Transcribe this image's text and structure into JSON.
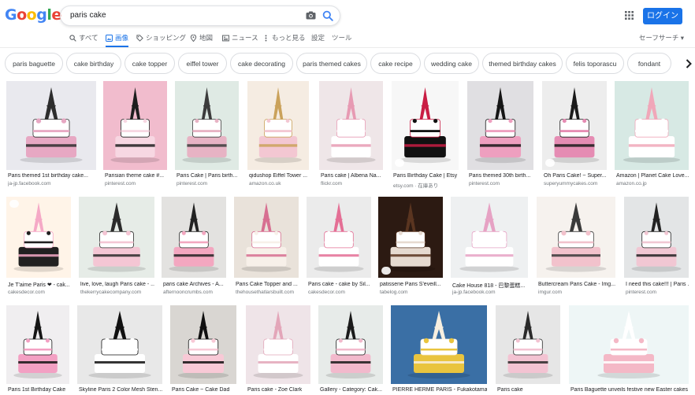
{
  "header": {
    "logo_letters": [
      "G",
      "o",
      "o",
      "g",
      "l",
      "e"
    ],
    "search_query": "paris cake",
    "login_label": "ログイン",
    "safesearch_label": "セーフサーチ ▾"
  },
  "tabs": [
    {
      "label": "すべて",
      "icon": "search-icon"
    },
    {
      "label": "画像",
      "icon": "image-icon",
      "active": true
    },
    {
      "label": "ショッピング",
      "icon": "tag-icon"
    },
    {
      "label": "地図",
      "icon": "map-pin-icon"
    },
    {
      "label": "ニュース",
      "icon": "news-icon"
    },
    {
      "label": "もっと見る",
      "icon": "more-icon"
    },
    {
      "label": "設定",
      "icon": ""
    },
    {
      "label": "ツール",
      "icon": ""
    }
  ],
  "chips": [
    "paris baguette",
    "cake birthday",
    "cake topper",
    "eiffel tower",
    "cake decorating",
    "paris themed cakes",
    "cake recipe",
    "wedding cake",
    "themed birthday cakes",
    "felis toporascu",
    "fondant"
  ],
  "results": [
    {
      "title": "Paris themed 1st birthday cake...",
      "source": "ja-jp.facebook.com",
      "colors": [
        "#e9e9ee",
        "#2d2d2d",
        "#e7a8c3"
      ]
    },
    {
      "title": "Parisian theme cake #...",
      "source": "pinterest.com",
      "colors": [
        "#f1bccd",
        "#1e1e1e",
        "#f7d7e2"
      ]
    },
    {
      "title": "Paris Cake | Paris birth...",
      "source": "pinterest.com",
      "colors": [
        "#dfeae4",
        "#3b3b3b",
        "#e7b3c4"
      ]
    },
    {
      "title": "qidushop Eiffel Tower ...",
      "source": "amazon.co.uk",
      "colors": [
        "#f5ece2",
        "#caa25b",
        "#f3c7d2"
      ]
    },
    {
      "title": "Paris cake | Albena Na...",
      "source": "flickr.com",
      "colors": [
        "#efe6e8",
        "#e79ab3",
        "#ffffff"
      ]
    },
    {
      "title": "Paris Birthday Cake | Etsy",
      "source": "etsy.com · 在庫あり",
      "colors": [
        "#f7f7f7",
        "#c91d44",
        "#111111"
      ],
      "badge": true
    },
    {
      "title": "Paris themed 30th birth...",
      "source": "pinterest.com",
      "colors": [
        "#e0dfe2",
        "#151515",
        "#ee9fbf"
      ]
    },
    {
      "title": "Oh Paris Cake! ~ Super...",
      "source": "superyummycakes.com",
      "colors": [
        "#ededed",
        "#1a1a1a",
        "#e58cb3"
      ],
      "badge": true
    },
    {
      "title": "Amazon | Planet Cake Love...",
      "source": "amazon.co.jp",
      "colors": [
        "#d7e9e4",
        "#f0a7b9",
        "#ffffff"
      ]
    },
    {
      "title": "Je T'aime Paris ❤ - cak...",
      "source": "cakesdecor.com",
      "colors": [
        "#fff4e8",
        "#f5a9c6",
        "#202020"
      ],
      "badge": true
    },
    {
      "title": "live, love, laugh Paris cake - ...",
      "source": "thekerrycakecompany.com",
      "colors": [
        "#e6ece7",
        "#2b2b2b",
        "#f4c6d4"
      ]
    },
    {
      "title": "paris cake Archives - A...",
      "source": "afternooncrumbs.com",
      "colors": [
        "#e3e2e0",
        "#222222",
        "#f3a7c0"
      ]
    },
    {
      "title": "Paris Cake Topper and ...",
      "source": "thehousethatlarsbuilt.com",
      "colors": [
        "#e9e2da",
        "#d76f91",
        "#f7f0e9"
      ]
    },
    {
      "title": "Paris cake - cake by Sil...",
      "source": "cakesdecor.com",
      "colors": [
        "#ebebeb",
        "#e46f95",
        "#ffffff"
      ]
    },
    {
      "title": "patisserie Paris S'eveill...",
      "source": "tabelog.com",
      "colors": [
        "#2c1a12",
        "#5a3520",
        "#e6dad0"
      ],
      "badge": true
    },
    {
      "title": "Cake House 818 - 巴黎蛋糕...",
      "source": "ja-jp.facebook.com",
      "colors": [
        "#eef0f1",
        "#e6a2c4",
        "#ffffff"
      ]
    },
    {
      "title": "Buttercream Paris Cake - Img...",
      "source": "imgur.com",
      "colors": [
        "#f6f2ee",
        "#3a3a3a",
        "#f2c2cc"
      ]
    },
    {
      "title": "I need this cake!!! | Paris ...",
      "source": "pinterest.com",
      "colors": [
        "#e3e5e6",
        "#222222",
        "#f1c7d3"
      ]
    },
    {
      "title": "Paris 1st Birthday Cake",
      "source": "",
      "colors": [
        "#f0eef0",
        "#151515",
        "#f3a0c3"
      ]
    },
    {
      "title": "Skyline Paris 2 Color Mesh Sten...",
      "source": "",
      "colors": [
        "#e8e8e8",
        "#111111",
        "#ffffff"
      ]
    },
    {
      "title": "Paris Cake ~ Cake Dad",
      "source": "",
      "colors": [
        "#d9d6d2",
        "#101010",
        "#f8c9d6"
      ]
    },
    {
      "title": "Paris cake - Zoe Clark",
      "source": "",
      "colors": [
        "#efe4e8",
        "#e3a6b9",
        "#ffffff"
      ]
    },
    {
      "title": "Gallery - Category: Cak...",
      "source": "",
      "colors": [
        "#e7ebe9",
        "#1a1a1a",
        "#f2b9cc"
      ]
    },
    {
      "title": "PIERRE HERMÉ PARIS - Fukakotamag...",
      "source": "",
      "colors": [
        "#3a6fa5",
        "#f7efe0",
        "#e9c43e"
      ]
    },
    {
      "title": "Paris cake",
      "source": "",
      "colors": [
        "#e6e6e6",
        "#2a2a2a",
        "#f3c3d2"
      ]
    },
    {
      "title": "Paris Baguette unveils festive new Easter cakes",
      "source": "",
      "colors": [
        "#eef6f6",
        "#ffffff",
        "#f4b8c6"
      ]
    }
  ]
}
